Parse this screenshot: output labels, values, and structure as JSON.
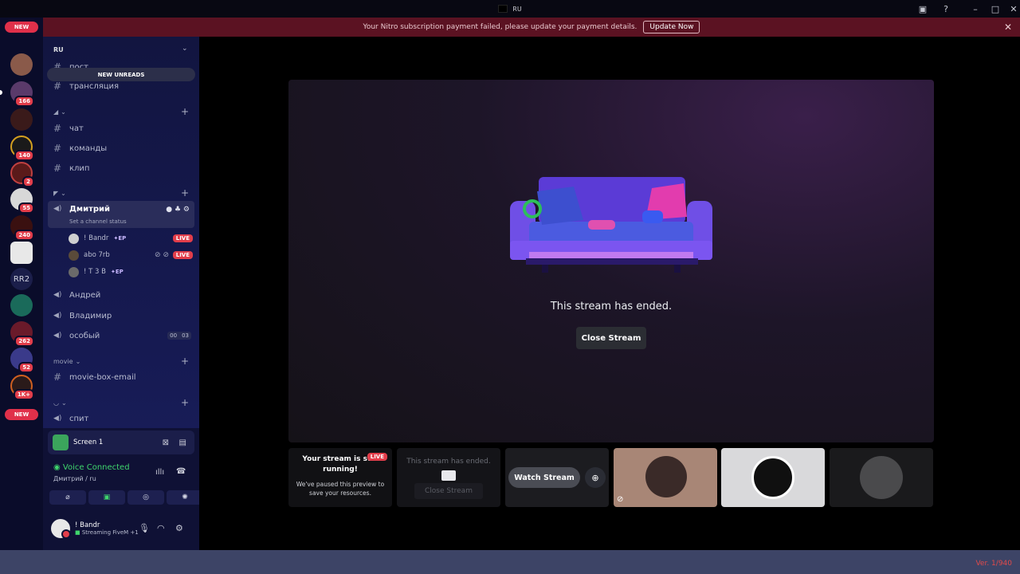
{
  "titlebar": {
    "title": "RU"
  },
  "notice": {
    "text": "Your Nitro subscription payment failed, please update your payment details.",
    "button": "Update Now"
  },
  "guilds": {
    "new_top": "NEW",
    "new_bottom": "NEW",
    "badges": [
      "166",
      "140",
      "2",
      "55",
      "240",
      "262",
      "52",
      "1K+"
    ],
    "text_icon": "RR2"
  },
  "sidebar": {
    "server_name": "RU",
    "new_unreads": "NEW UNREADS",
    "channels_top": [
      "пост",
      "трансляция"
    ],
    "channels_text": [
      "чат",
      "команды",
      "клип"
    ],
    "voice_active": {
      "name": "Дмитрий",
      "status_prompt": "Set a channel status",
      "users": [
        {
          "name": "! Bandr",
          "tag": "EP",
          "live": "LIVE"
        },
        {
          "name": "abo 7rb",
          "live": "LIVE"
        },
        {
          "name": "! T 3 B",
          "tag": "EP"
        }
      ]
    },
    "voice_others": [
      "Андрей",
      "Владимир",
      "особый"
    ],
    "osobiy_counts": [
      "00",
      "03"
    ],
    "category_movie": "movie",
    "channels_movie": [
      "movie-box-email"
    ],
    "channels_last": [
      "спит"
    ]
  },
  "panel": {
    "screen_label": "Screen 1",
    "voice_status": "Voice Connected",
    "voice_location": "Дмитрий / ru",
    "user_name": "! Bandr",
    "user_status": "Streaming FiveM +1"
  },
  "stage": {
    "ended_text": "This stream has ended.",
    "close_button": "Close Stream"
  },
  "tiles": {
    "running_title": "Your stream is still running!",
    "running_sub": "We've paused this preview to save your resources.",
    "live_badge": "LIVE",
    "ended_text": "This stream has ended.",
    "close_text": "Close Stream",
    "watch_button": "Watch Stream"
  },
  "footer": {
    "version": "Ver. 1/940"
  }
}
